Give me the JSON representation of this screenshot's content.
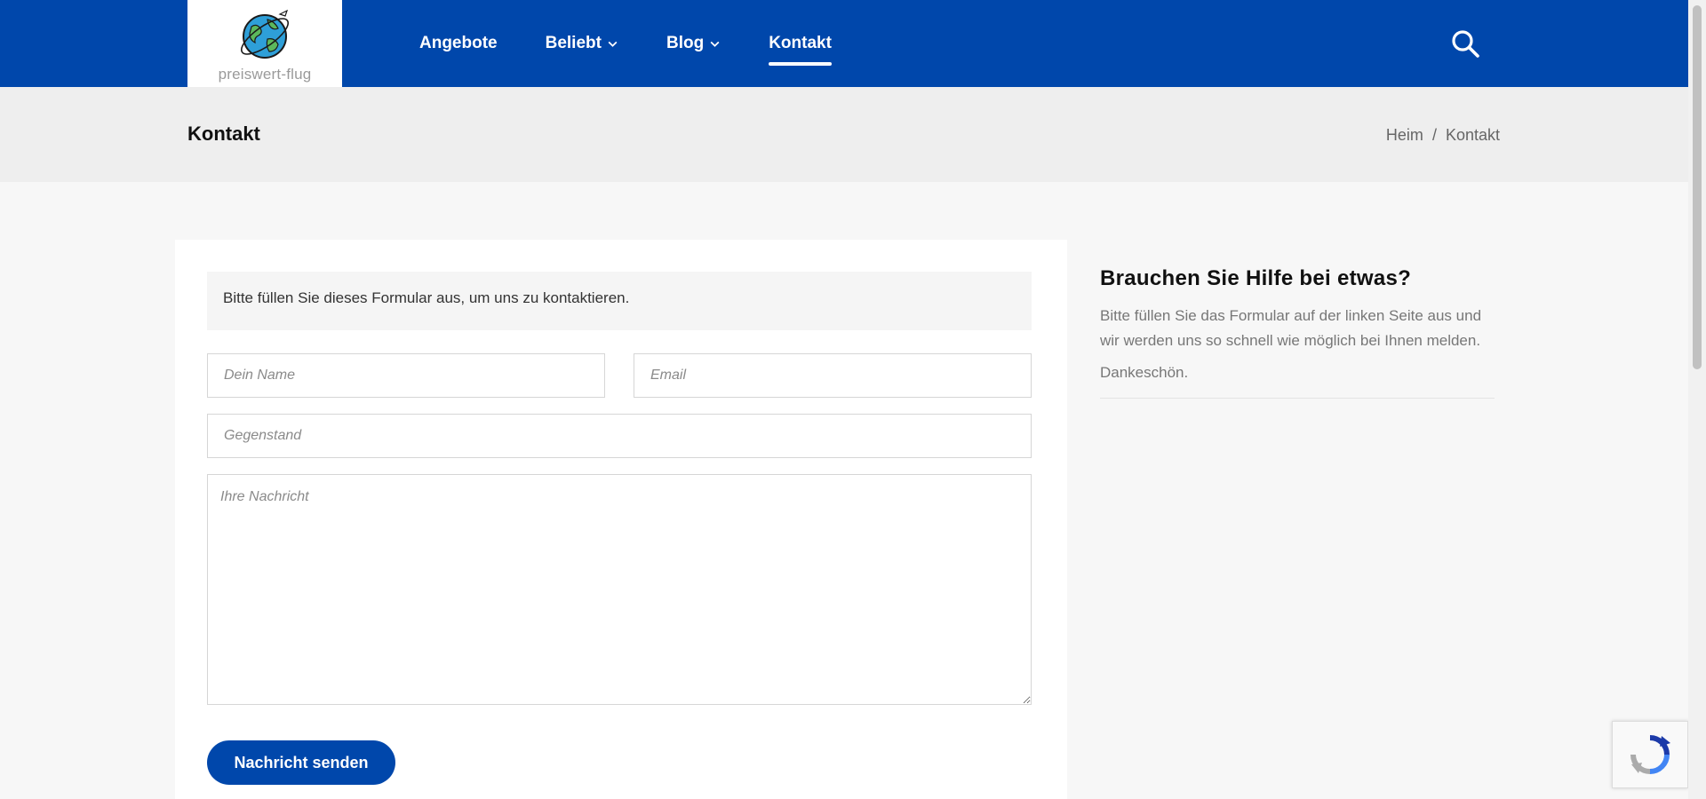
{
  "logo": {
    "text": "preiswert-flug"
  },
  "nav": {
    "items": [
      {
        "label": "Angebote",
        "has_dropdown": false,
        "active": false
      },
      {
        "label": "Beliebt",
        "has_dropdown": true,
        "active": false
      },
      {
        "label": "Blog",
        "has_dropdown": true,
        "active": false
      },
      {
        "label": "Kontakt",
        "has_dropdown": false,
        "active": true
      }
    ],
    "search_icon": "search-icon"
  },
  "title_band": {
    "title": "Kontakt",
    "breadcrumb": {
      "home": "Heim",
      "separator": "/",
      "current": "Kontakt"
    }
  },
  "form": {
    "intro": "Bitte füllen Sie dieses Formular aus, um uns zu kontaktieren.",
    "name_placeholder": "Dein Name",
    "email_placeholder": "Email",
    "subject_placeholder": "Gegenstand",
    "message_placeholder": "Ihre Nachricht",
    "submit_label": "Nachricht senden"
  },
  "sidebar": {
    "title": "Brauchen Sie Hilfe bei etwas?",
    "text": "Bitte füllen Sie das Formular auf der linken Seite aus und wir werden uns so schnell wie möglich bei Ihnen melden.",
    "thanks": "Dankeschön."
  },
  "colors": {
    "brand": "#0047ab",
    "title_band": "#eeeeee",
    "background": "#f7f7f7"
  }
}
